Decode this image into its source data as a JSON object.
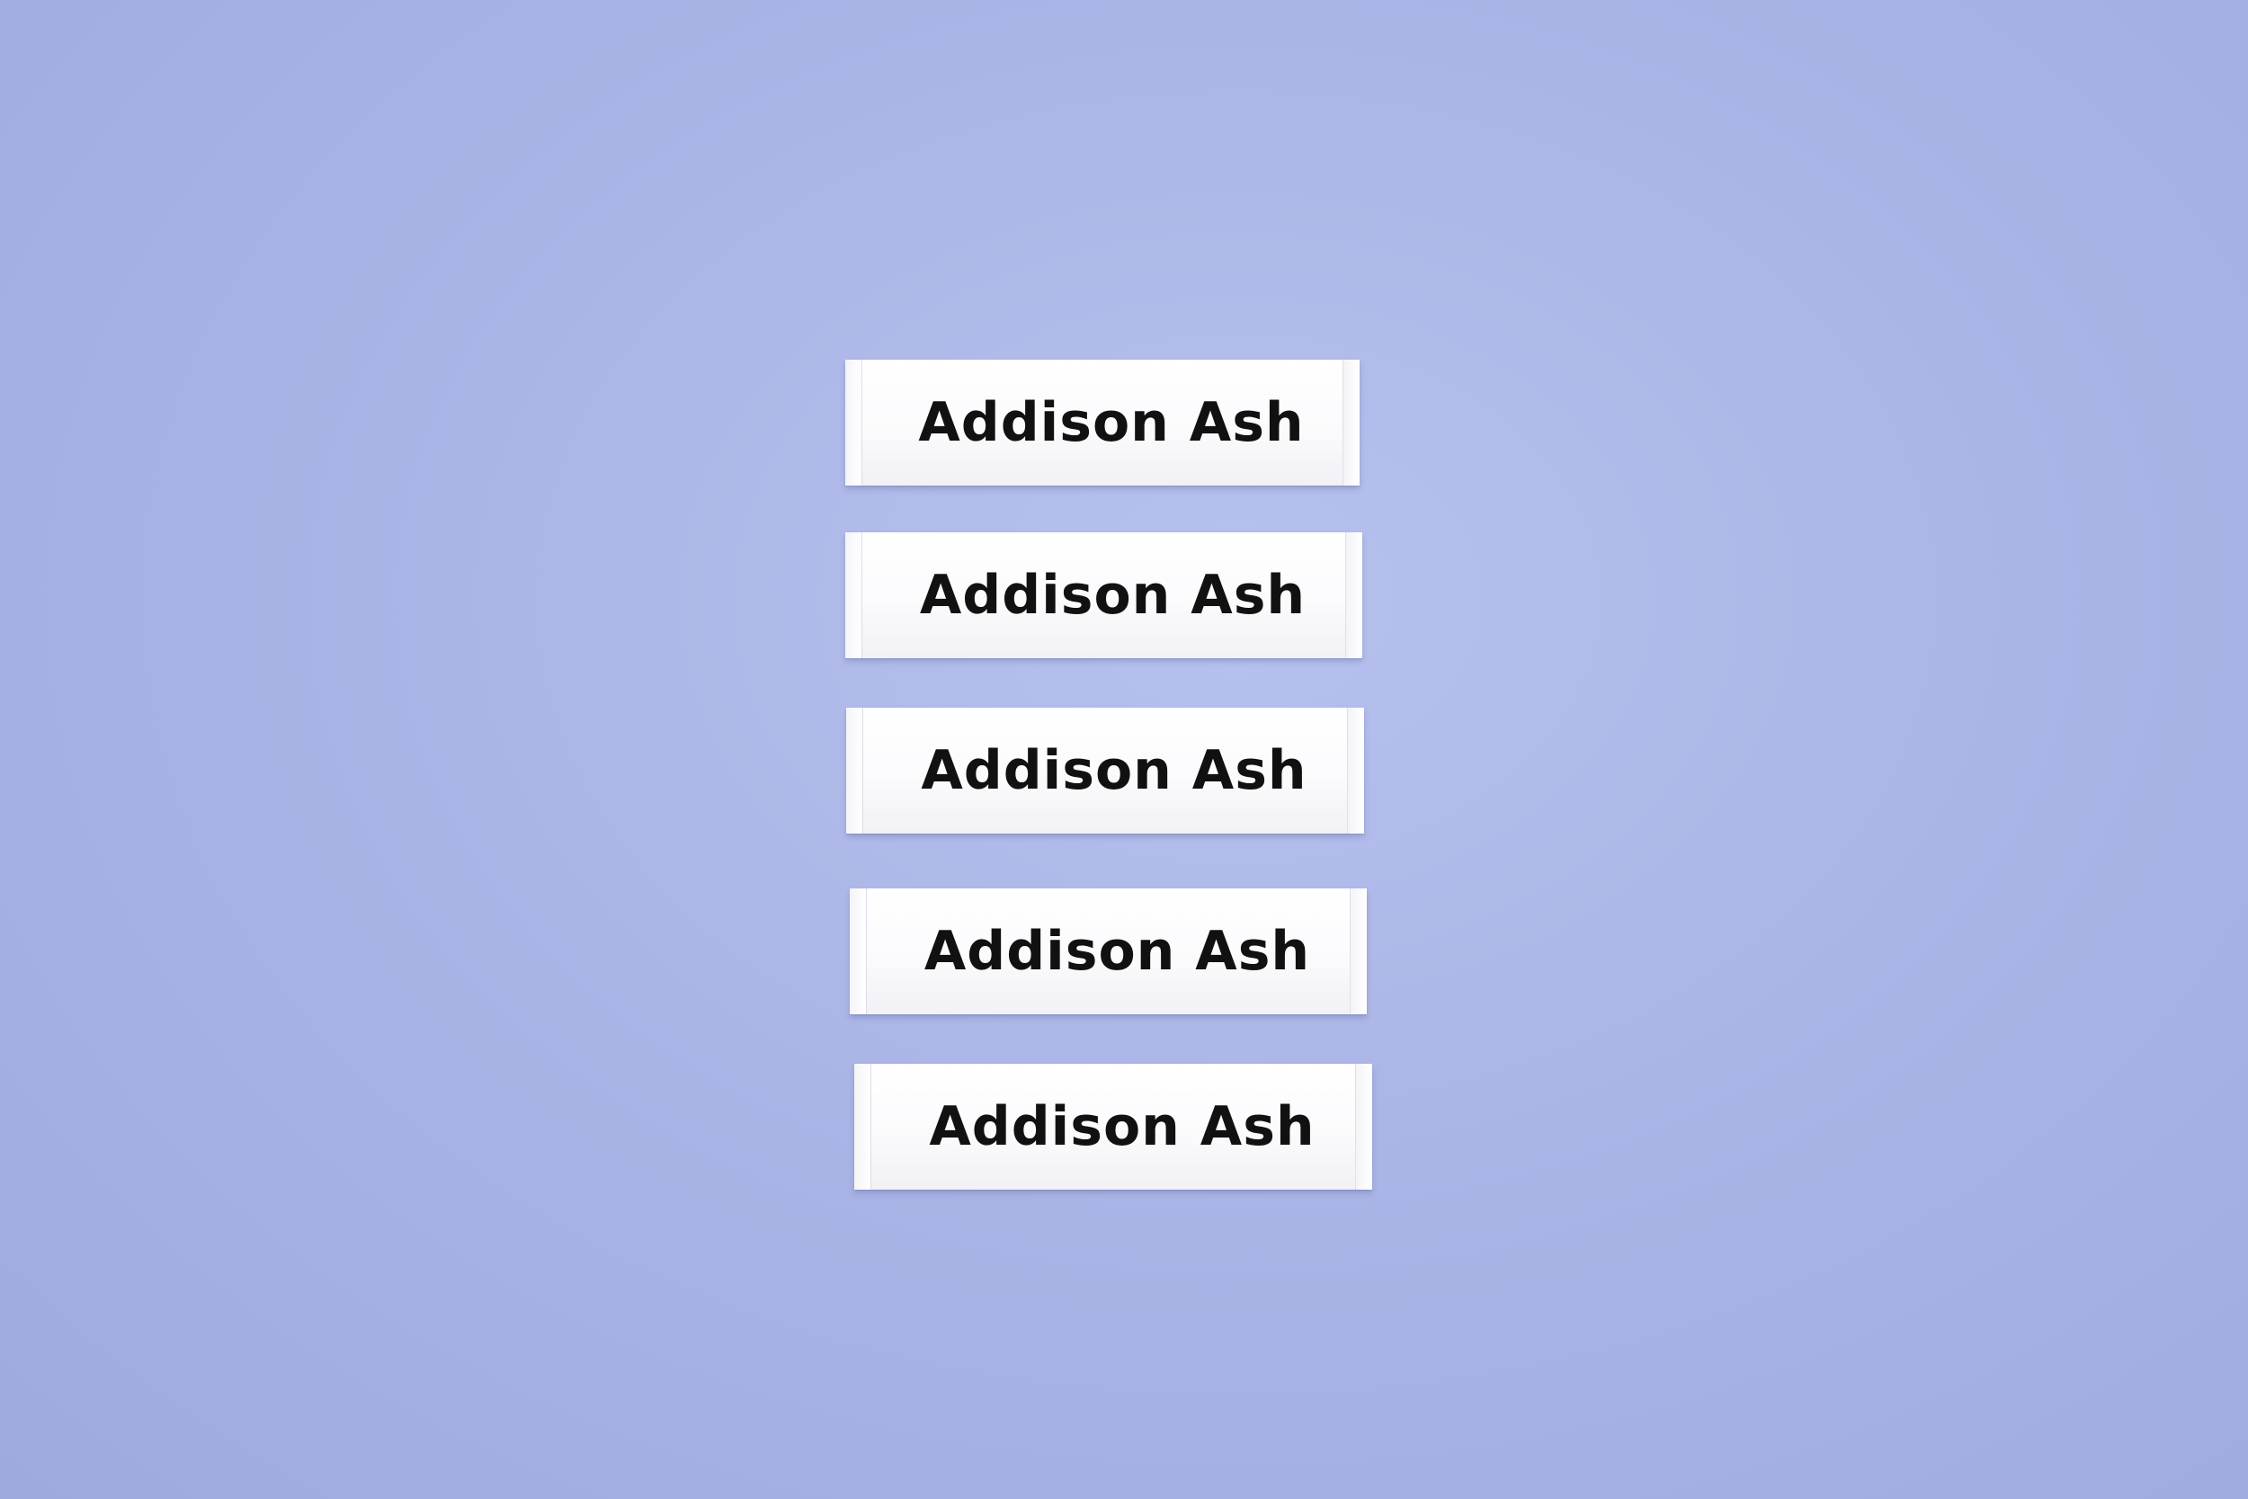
{
  "background_color": "#aab5e6",
  "label_color": "#ffffff",
  "text_color": "#111111",
  "labels": [
    {
      "text": "Addison Ash"
    },
    {
      "text": "Addison Ash"
    },
    {
      "text": "Addison Ash"
    },
    {
      "text": "Addison Ash"
    },
    {
      "text": "Addison Ash"
    }
  ]
}
